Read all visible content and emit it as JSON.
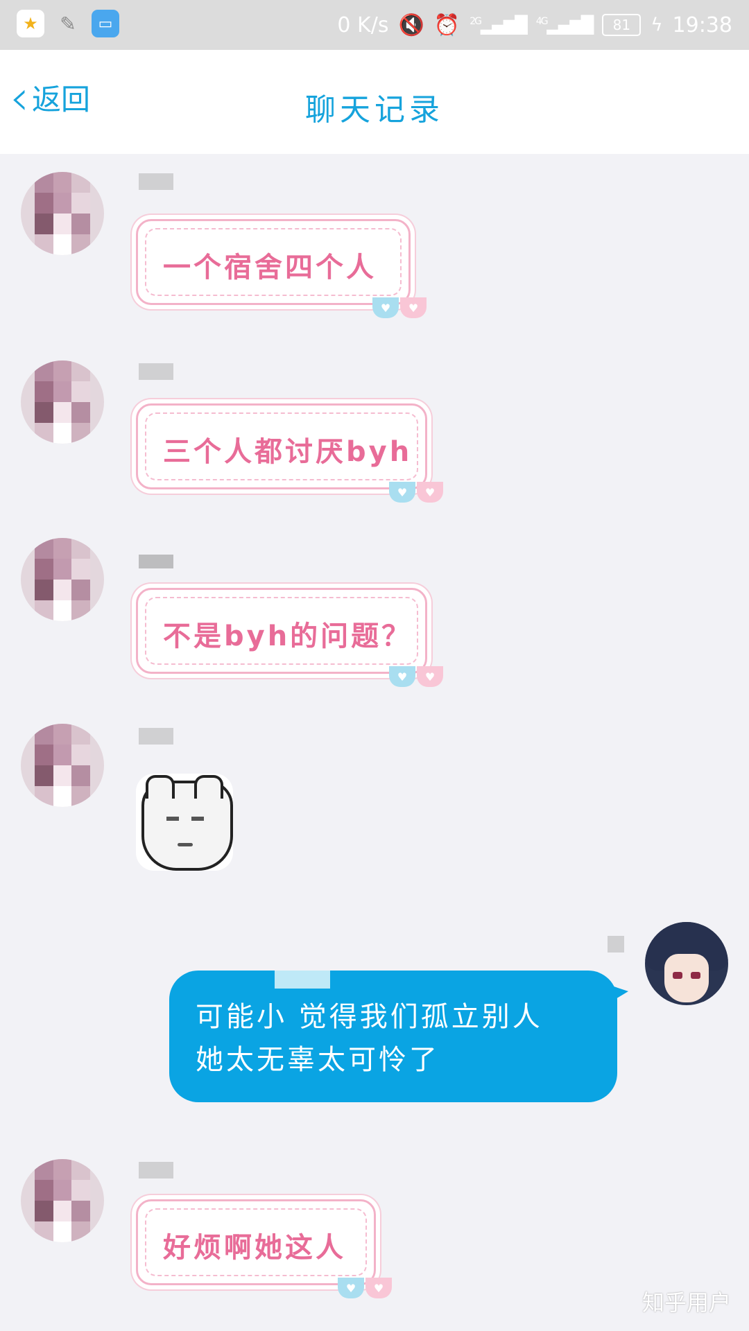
{
  "status_bar": {
    "network_speed": "0 K/s",
    "network_2g": "2G",
    "network_4g": "4G",
    "battery": "81",
    "time": "19:38"
  },
  "header": {
    "back_label": "返回",
    "title": "聊天记录"
  },
  "messages": [
    {
      "text": "一个宿舍四个人"
    },
    {
      "text": "三个人都讨厌byh"
    },
    {
      "text": "不是byh的问题？"
    },
    {
      "sticker": "sad-face-sticker"
    },
    {
      "text": "可能小  觉得我们孤立别人\n她太无辜太可怜了"
    },
    {
      "text": "好烦啊她这人"
    }
  ],
  "watermark": "知乎用户",
  "colors": {
    "accent": "#16a3dc",
    "self_bubble": "#0aa4e3",
    "pink_text": "#e86c98"
  }
}
